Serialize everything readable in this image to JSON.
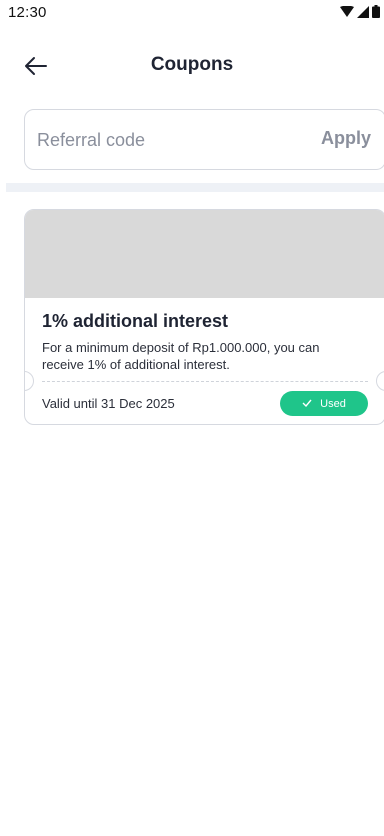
{
  "status_bar": {
    "time": "12:30",
    "icons": [
      "wifi-icon",
      "signal-icon",
      "battery-icon"
    ]
  },
  "header": {
    "title": "Coupons",
    "back_icon": "arrow-left-icon"
  },
  "referral": {
    "placeholder": "Referral code",
    "value": "",
    "apply_label": "Apply"
  },
  "coupons": [
    {
      "title": "1% additional interest",
      "description": "For a minimum deposit of Rp1.000.000, you can receive 1% of additional interest.",
      "validity": "Valid until 31 Dec 2025",
      "status": "Used",
      "status_icon": "check-icon"
    }
  ],
  "colors": {
    "accent_green": "#1fc58a",
    "text_dark": "#1f2433",
    "muted": "#8a8f9c",
    "image_placeholder": "#d9d9d9"
  }
}
